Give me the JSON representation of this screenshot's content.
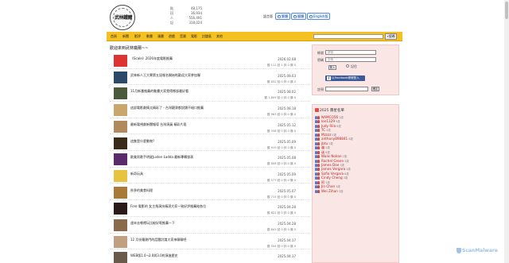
{
  "logo": {
    "text": "武林鐵爾"
  },
  "stats": [
    {
      "key": "貼",
      "value": "48,175"
    },
    {
      "key": "回",
      "value": "36,934"
    },
    {
      "key": "人",
      "value": "556,491"
    },
    {
      "key": "記",
      "value": "318,024"
    }
  ],
  "lang": {
    "label": "語言版",
    "buttons": [
      "繁體",
      "簡體",
      "English版"
    ]
  },
  "nav": {
    "items": [
      "首頁",
      "新聞",
      "影評",
      "動畫",
      "漫畫",
      "遊戲",
      "音樂",
      "電影",
      "討論區",
      "其他"
    ],
    "search_placeholder": "",
    "search_button": "搜尋"
  },
  "welcome": "歡迎來到武林鐵爾~~",
  "posts": [
    {
      "title": "《Scale》2026年度電影推薦",
      "date": "2026.02.08",
      "meta": "觀 112 回 1 評 0 讚 0",
      "color": "#d33"
    },
    {
      "title": "武林新人王大賽第五屆報名開始啦歡迎大家參加喔",
      "date": "2025.08.03",
      "meta": "觀 832 回 0 評 0 讚 0",
      "color": "#2a4a6a"
    },
    {
      "title": "11月新番推薦的動畫大家覺得哪部最好看",
      "date": "2025.08.02",
      "meta": "觀 1,809 回 0 評 0 讚 0",
      "color": "#4a5a3a"
    },
    {
      "title": "這部電影劇情太精彩了 - 台灣觀眾都說讚不絕口推薦",
      "date": "2025.08.18",
      "meta": "觀 983 回 0 評 0 讚 0",
      "color": "#c9a66b"
    },
    {
      "title": "最新電視劇新聞報導 台灣演員 精彩片段",
      "date": "2025.05.12",
      "meta": "觀 558 回 0 評 0 讚 0",
      "color": "#b08a5c"
    },
    {
      "title": "這隻是什麼動物?",
      "date": "2025.05.09",
      "meta": "觀 919 回 0 評 0 讚 0",
      "color": "#3a2a1a"
    },
    {
      "title": "歐美男歌手明星Justen Ladda 最新專輯發表",
      "date": "2025.05.08",
      "meta": "觀 808 回 0 評 0 讚 0",
      "color": "#5a2a6a"
    },
    {
      "title": "新奇玩具",
      "date": "2025.05.09",
      "meta": "觀 577 回 0 評 0 讚 0",
      "color": "#e8c340"
    },
    {
      "title": "秋季的美食料理",
      "date": "2025.05.07",
      "meta": "觀 715 回 0 評 0 讚 0",
      "color": "#a87a3a"
    },
    {
      "title": "Fore 電影的 女主角演技精湛大家一致好評推薦給各位",
      "date": "2025.04.28",
      "meta": "觀 822 回 0 評 0 讚 0",
      "color": "#2a1a1a"
    },
    {
      "title": "週末去哪裡玩比較好呢推薦一下",
      "date": "2025.04.28",
      "meta": "觀 843 回 0 評 0 讚 0",
      "color": "#8a6a4a"
    },
    {
      "title": "12 月份最熱門的話題討論大家來聊聊吧",
      "date": "2025.04.17",
      "meta": "觀 554 回 0 評 0 讚 0",
      "color": "#c0a080"
    },
    {
      "title": "WEB版1.0→2.0與3.0的演進歷史",
      "date": "2025.04.17",
      "meta": "",
      "color": "#6a5a4a"
    }
  ],
  "login": {
    "account_label": "帳號",
    "account_placeholder": "帳號",
    "password_label": "密碼",
    "password_placeholder": "密碼",
    "remember_label": "記住",
    "login_button": "登入",
    "facebook_button": "以Facebook帳號登入",
    "register_label": "註冊",
    "register_button": "確定"
  },
  "birthdays": {
    "title": "2025 壽星名單",
    "items": [
      {
        "name": "NAMCO56",
        "age": "3歲"
      },
      {
        "name": "lon1329",
        "age": "9歲"
      },
      {
        "name": "Judy Rila",
        "age": "6歲"
      },
      {
        "name": "TC",
        "age": "4歲"
      },
      {
        "name": "Mzzzz",
        "age": "5歲"
      },
      {
        "name": "anthony898841",
        "age": "6歲"
      },
      {
        "name": "jbtu",
        "age": "2歲"
      },
      {
        "name": "貓",
        "age": "2歲"
      },
      {
        "name": "迷",
        "age": "6歲"
      },
      {
        "name": "Walis Nokan",
        "age": "2歲"
      },
      {
        "name": "Rachel Green",
        "age": "3歲"
      },
      {
        "name": "James Doe",
        "age": "3歲"
      },
      {
        "name": "James Vergara",
        "age": "2歲"
      },
      {
        "name": "Sofia Vergara",
        "age": "6歲"
      },
      {
        "name": "Cindy Cheng",
        "age": "3歲"
      },
      {
        "name": "阿",
        "age": "2歲"
      },
      {
        "name": "Jin Chen",
        "age": "3歲"
      },
      {
        "name": "Wei Zihan",
        "age": "3歲"
      }
    ]
  },
  "watermark": "ScanMalware"
}
